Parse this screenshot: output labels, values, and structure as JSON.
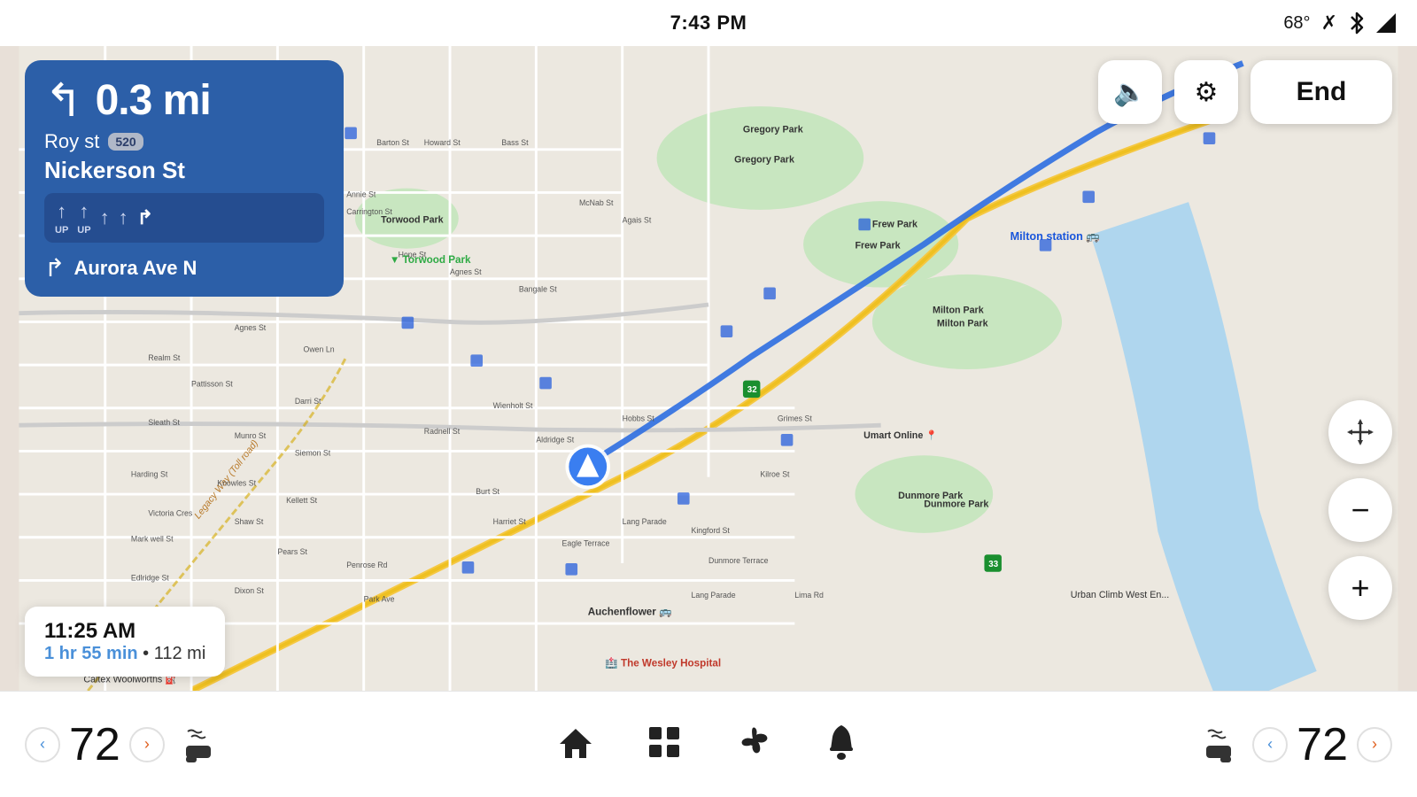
{
  "statusBar": {
    "time": "7:43 PM",
    "temperature": "68°",
    "bluetooth": "BT",
    "signal": "▲"
  },
  "navCard": {
    "distance": "0.3 mi",
    "turnArrow": "↪",
    "streetLine1": "Roy st",
    "routeBadge": "520",
    "streetLine2": "Nickerson St",
    "lanes": [
      {
        "label": "UP",
        "arrow": "↑"
      },
      {
        "label": "UP",
        "arrow": "↑"
      },
      {
        "label": "",
        "arrow": "↑"
      },
      {
        "label": "",
        "arrow": "↑"
      },
      {
        "label": "",
        "arrow": "↪"
      }
    ],
    "viaLabel": "Aurora Ave N"
  },
  "etaCard": {
    "arrivalTime": "11:25 AM",
    "duration": "1 hr 55 min",
    "distance": "112 mi"
  },
  "topControls": {
    "volumeIcon": "🔈",
    "settingsIcon": "⚙",
    "endLabel": "End"
  },
  "mapControls": {
    "moveIcon": "⊕",
    "zoomOut": "−",
    "zoomIn": "+"
  },
  "bottomBar": {
    "leftTemp": "72",
    "leftDecBtn": "<",
    "leftIncBtn": ">",
    "leftHeatIcon": "seat-heat",
    "homeIcon": "home",
    "gridIcon": "grid",
    "fanIcon": "fan",
    "bellIcon": "bell",
    "rightHeatIcon": "seat-heat-right",
    "rightTemp": "72",
    "rightDecBtn": "<",
    "rightIncBtn": ">"
  }
}
